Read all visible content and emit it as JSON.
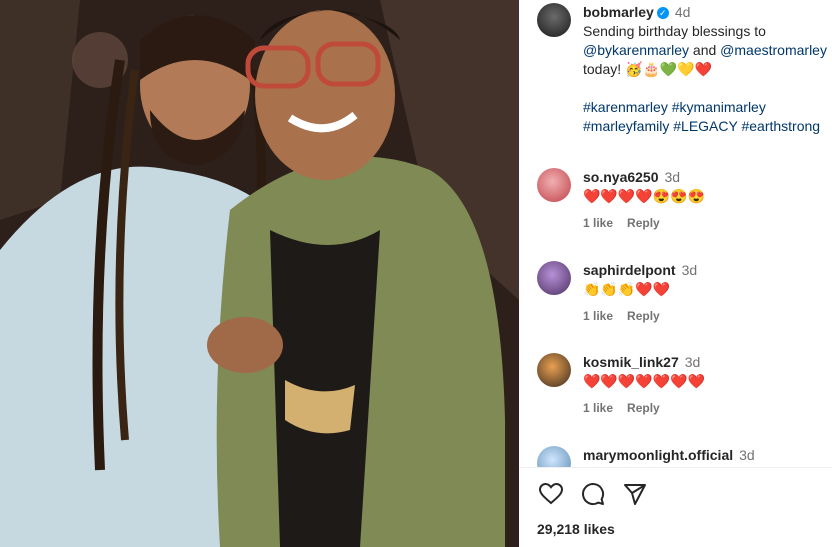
{
  "post": {
    "username": "bobmarley",
    "time": "4d",
    "caption_line1": "Sending birthday blessings to",
    "mention1": "@bykarenmarley",
    "and": "and",
    "mention2": "@maestromarley",
    "today": "today!",
    "emoji_line": "🥳🎂💚💛❤️",
    "hashtags_line1": "#karenmarley #kymanimarley",
    "hashtags_line2": "#marleyfamily #LEGACY #earthstrong"
  },
  "comments": [
    {
      "username": "so.nya6250",
      "time": "3d",
      "text": "❤️❤️❤️❤️😍😍😍",
      "likes": "1 like",
      "reply": "Reply"
    },
    {
      "username": "saphirdelpont",
      "time": "3d",
      "text": "👏👏👏❤️❤️",
      "likes": "1 like",
      "reply": "Reply"
    },
    {
      "username": "kosmik_link27",
      "time": "3d",
      "text": "❤️❤️❤️❤️❤️❤️❤️",
      "likes": "1 like",
      "reply": "Reply"
    },
    {
      "username": "marymoonlight.official",
      "time": "3d",
      "text": "👏👏👏👏"
    }
  ],
  "footer": {
    "likes": "29,218 likes"
  },
  "colors": {
    "link": "#00376b",
    "verified": "#0095f6",
    "heart": "#ed4956"
  }
}
